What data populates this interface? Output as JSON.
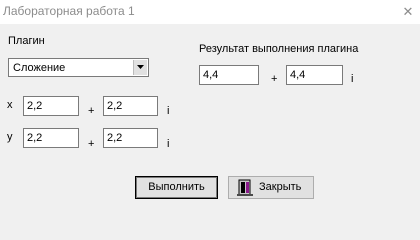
{
  "window": {
    "title": "Лабораторная работа 1",
    "close_glyph": "✕"
  },
  "plugin": {
    "label": "Плагин",
    "selected": "Сложение"
  },
  "result": {
    "label": "Результат выполнения плагина",
    "real": "4,4",
    "plus": "+",
    "imag": "4,4",
    "i": "i"
  },
  "x": {
    "label": "x",
    "real": "2,2",
    "plus": "+",
    "imag": "2,2",
    "i": "i"
  },
  "y": {
    "label": "y",
    "real": "2,2",
    "plus": "+",
    "imag": "2,2",
    "i": "i"
  },
  "buttons": {
    "run": "Выполнить",
    "close": "Закрыть"
  },
  "icons": {
    "combo_arrow": "chevron-down-icon",
    "close_button_icon": "door-exit-icon"
  }
}
